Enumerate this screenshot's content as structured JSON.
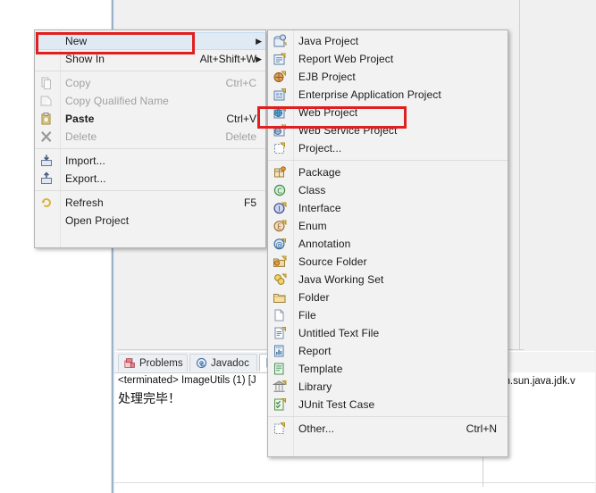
{
  "app": {
    "kind": "eclipse-ide-context-menu"
  },
  "console": {
    "tabs": [
      {
        "label": "Problems",
        "icon": "problems-icon",
        "active": false
      },
      {
        "label": "Javadoc",
        "icon": "javadoc-icon",
        "active": false
      },
      {
        "label": "",
        "icon": "declaration-icon",
        "active": true
      }
    ],
    "terminated_line": "<terminated> ImageUtils (1) [J",
    "output_line": "处理完毕！",
    "right_path": "\\com.sun.java.jdk.v"
  },
  "context_menu": {
    "items": [
      {
        "label": "New",
        "accel": "",
        "submenu": true,
        "disabled": false,
        "bold": false,
        "icon": "",
        "highlight": true
      },
      {
        "label": "Show In",
        "accel": "Alt+Shift+W",
        "submenu": true,
        "disabled": false,
        "bold": false,
        "icon": "",
        "highlight": false
      },
      {
        "separator": true
      },
      {
        "label": "Copy",
        "accel": "Ctrl+C",
        "submenu": false,
        "disabled": true,
        "bold": false,
        "icon": "copy-icon",
        "highlight": false
      },
      {
        "label": "Copy Qualified Name",
        "accel": "",
        "submenu": false,
        "disabled": true,
        "bold": false,
        "icon": "copy-qualified-icon",
        "highlight": false
      },
      {
        "label": "Paste",
        "accel": "Ctrl+V",
        "submenu": false,
        "disabled": false,
        "bold": true,
        "icon": "paste-icon",
        "highlight": false
      },
      {
        "label": "Delete",
        "accel": "Delete",
        "submenu": false,
        "disabled": true,
        "bold": false,
        "icon": "delete-icon",
        "highlight": false
      },
      {
        "separator": true
      },
      {
        "label": "Import...",
        "accel": "",
        "submenu": false,
        "disabled": false,
        "bold": false,
        "icon": "import-icon",
        "highlight": false
      },
      {
        "label": "Export...",
        "accel": "",
        "submenu": false,
        "disabled": false,
        "bold": false,
        "icon": "export-icon",
        "highlight": false
      },
      {
        "separator": true
      },
      {
        "label": "Refresh",
        "accel": "F5",
        "submenu": false,
        "disabled": false,
        "bold": false,
        "icon": "refresh-icon",
        "highlight": false
      },
      {
        "label": "Open Project",
        "accel": "",
        "submenu": false,
        "disabled": false,
        "bold": false,
        "icon": "",
        "highlight": false
      }
    ]
  },
  "new_submenu": {
    "items": [
      {
        "label": "Java Project",
        "accel": "",
        "icon": "java-project-icon"
      },
      {
        "label": "Report Web Project",
        "accel": "",
        "icon": "report-web-project-icon"
      },
      {
        "label": "EJB Project",
        "accel": "",
        "icon": "ejb-project-icon"
      },
      {
        "label": "Enterprise Application Project",
        "accel": "",
        "icon": "enterprise-app-project-icon"
      },
      {
        "label": "Web Project",
        "accel": "",
        "icon": "web-project-icon"
      },
      {
        "label": "Web Service Project",
        "accel": "",
        "icon": "web-service-project-icon"
      },
      {
        "label": "Project...",
        "accel": "",
        "icon": "project-icon"
      },
      {
        "separator": true
      },
      {
        "label": "Package",
        "accel": "",
        "icon": "package-icon"
      },
      {
        "label": "Class",
        "accel": "",
        "icon": "class-icon"
      },
      {
        "label": "Interface",
        "accel": "",
        "icon": "interface-icon"
      },
      {
        "label": "Enum",
        "accel": "",
        "icon": "enum-icon"
      },
      {
        "label": "Annotation",
        "accel": "",
        "icon": "annotation-icon"
      },
      {
        "label": "Source Folder",
        "accel": "",
        "icon": "source-folder-icon"
      },
      {
        "label": "Java Working Set",
        "accel": "",
        "icon": "java-working-set-icon"
      },
      {
        "label": "Folder",
        "accel": "",
        "icon": "folder-icon"
      },
      {
        "label": "File",
        "accel": "",
        "icon": "file-icon"
      },
      {
        "label": "Untitled Text File",
        "accel": "",
        "icon": "untitled-text-file-icon"
      },
      {
        "label": "Report",
        "accel": "",
        "icon": "report-icon"
      },
      {
        "label": "Template",
        "accel": "",
        "icon": "template-icon"
      },
      {
        "label": "Library",
        "accel": "",
        "icon": "library-icon"
      },
      {
        "label": "JUnit Test Case",
        "accel": "",
        "icon": "junit-test-case-icon"
      },
      {
        "separator": true
      },
      {
        "label": "Other...",
        "accel": "Ctrl+N",
        "icon": "other-icon"
      }
    ]
  },
  "annotations": {
    "color": "#e02020",
    "boxes": [
      {
        "target": "New"
      },
      {
        "target": "Web Project"
      }
    ]
  }
}
